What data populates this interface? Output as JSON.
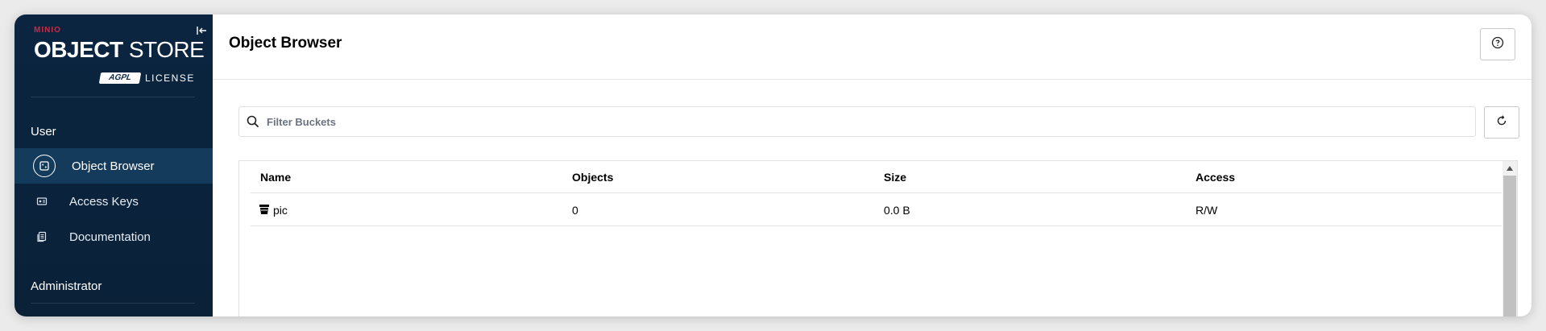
{
  "sidebar": {
    "logo": {
      "brand": "MINIO",
      "product_bold": "OBJECT",
      "product_rest": " STORE",
      "edition_badge": "AGPL",
      "license": "LICENSE"
    },
    "sections": {
      "user": "User",
      "admin": "Administrator"
    },
    "items": [
      {
        "label": "Object Browser",
        "icon": "bucket-circle-icon",
        "active": true
      },
      {
        "label": "Access Keys",
        "icon": "id-card-icon",
        "active": false
      },
      {
        "label": "Documentation",
        "icon": "document-icon",
        "active": false
      }
    ]
  },
  "header": {
    "title": "Object Browser"
  },
  "search": {
    "placeholder": "Filter Buckets",
    "value": ""
  },
  "table": {
    "columns": [
      "Name",
      "Objects",
      "Size",
      "Access"
    ],
    "rows": [
      {
        "name": "pic",
        "objects": "0",
        "size": "0.0 B",
        "access": "R/W"
      }
    ]
  },
  "colors": {
    "sidebar_bg": "#0b2540",
    "sidebar_active": "#153b5c",
    "brand_red": "#c72c48"
  }
}
